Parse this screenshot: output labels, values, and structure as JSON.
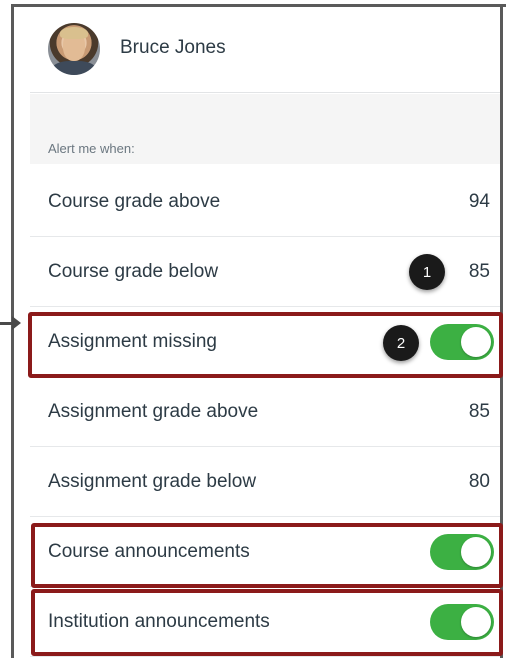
{
  "user": {
    "name": "Bruce Jones"
  },
  "section_label": "Alert me when:",
  "rows": [
    {
      "label": "Course grade above",
      "value": "94"
    },
    {
      "label": "Course grade below",
      "value": "85"
    },
    {
      "label": "Assignment missing",
      "toggle_on": true
    },
    {
      "label": "Assignment grade above",
      "value": "85"
    },
    {
      "label": "Assignment grade below",
      "value": "80"
    },
    {
      "label": "Course announcements",
      "toggle_on": true
    },
    {
      "label": "Institution announcements",
      "toggle_on": true
    }
  ],
  "callouts": [
    "1",
    "2"
  ],
  "colors": {
    "toggle_on": "#3cb043",
    "highlight": "#8b1a1a",
    "text": "#2d3b45"
  }
}
